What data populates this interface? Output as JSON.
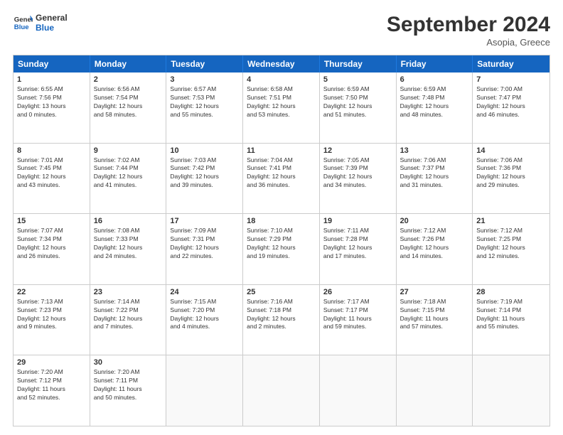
{
  "logo": {
    "line1": "General",
    "line2": "Blue"
  },
  "title": "September 2024",
  "location": "Asopia, Greece",
  "header_days": [
    "Sunday",
    "Monday",
    "Tuesday",
    "Wednesday",
    "Thursday",
    "Friday",
    "Saturday"
  ],
  "weeks": [
    [
      {
        "day": "1",
        "info": "Sunrise: 6:55 AM\nSunset: 7:56 PM\nDaylight: 13 hours\nand 0 minutes."
      },
      {
        "day": "2",
        "info": "Sunrise: 6:56 AM\nSunset: 7:54 PM\nDaylight: 12 hours\nand 58 minutes."
      },
      {
        "day": "3",
        "info": "Sunrise: 6:57 AM\nSunset: 7:53 PM\nDaylight: 12 hours\nand 55 minutes."
      },
      {
        "day": "4",
        "info": "Sunrise: 6:58 AM\nSunset: 7:51 PM\nDaylight: 12 hours\nand 53 minutes."
      },
      {
        "day": "5",
        "info": "Sunrise: 6:59 AM\nSunset: 7:50 PM\nDaylight: 12 hours\nand 51 minutes."
      },
      {
        "day": "6",
        "info": "Sunrise: 6:59 AM\nSunset: 7:48 PM\nDaylight: 12 hours\nand 48 minutes."
      },
      {
        "day": "7",
        "info": "Sunrise: 7:00 AM\nSunset: 7:47 PM\nDaylight: 12 hours\nand 46 minutes."
      }
    ],
    [
      {
        "day": "8",
        "info": "Sunrise: 7:01 AM\nSunset: 7:45 PM\nDaylight: 12 hours\nand 43 minutes."
      },
      {
        "day": "9",
        "info": "Sunrise: 7:02 AM\nSunset: 7:44 PM\nDaylight: 12 hours\nand 41 minutes."
      },
      {
        "day": "10",
        "info": "Sunrise: 7:03 AM\nSunset: 7:42 PM\nDaylight: 12 hours\nand 39 minutes."
      },
      {
        "day": "11",
        "info": "Sunrise: 7:04 AM\nSunset: 7:41 PM\nDaylight: 12 hours\nand 36 minutes."
      },
      {
        "day": "12",
        "info": "Sunrise: 7:05 AM\nSunset: 7:39 PM\nDaylight: 12 hours\nand 34 minutes."
      },
      {
        "day": "13",
        "info": "Sunrise: 7:06 AM\nSunset: 7:37 PM\nDaylight: 12 hours\nand 31 minutes."
      },
      {
        "day": "14",
        "info": "Sunrise: 7:06 AM\nSunset: 7:36 PM\nDaylight: 12 hours\nand 29 minutes."
      }
    ],
    [
      {
        "day": "15",
        "info": "Sunrise: 7:07 AM\nSunset: 7:34 PM\nDaylight: 12 hours\nand 26 minutes."
      },
      {
        "day": "16",
        "info": "Sunrise: 7:08 AM\nSunset: 7:33 PM\nDaylight: 12 hours\nand 24 minutes."
      },
      {
        "day": "17",
        "info": "Sunrise: 7:09 AM\nSunset: 7:31 PM\nDaylight: 12 hours\nand 22 minutes."
      },
      {
        "day": "18",
        "info": "Sunrise: 7:10 AM\nSunset: 7:29 PM\nDaylight: 12 hours\nand 19 minutes."
      },
      {
        "day": "19",
        "info": "Sunrise: 7:11 AM\nSunset: 7:28 PM\nDaylight: 12 hours\nand 17 minutes."
      },
      {
        "day": "20",
        "info": "Sunrise: 7:12 AM\nSunset: 7:26 PM\nDaylight: 12 hours\nand 14 minutes."
      },
      {
        "day": "21",
        "info": "Sunrise: 7:12 AM\nSunset: 7:25 PM\nDaylight: 12 hours\nand 12 minutes."
      }
    ],
    [
      {
        "day": "22",
        "info": "Sunrise: 7:13 AM\nSunset: 7:23 PM\nDaylight: 12 hours\nand 9 minutes."
      },
      {
        "day": "23",
        "info": "Sunrise: 7:14 AM\nSunset: 7:22 PM\nDaylight: 12 hours\nand 7 minutes."
      },
      {
        "day": "24",
        "info": "Sunrise: 7:15 AM\nSunset: 7:20 PM\nDaylight: 12 hours\nand 4 minutes."
      },
      {
        "day": "25",
        "info": "Sunrise: 7:16 AM\nSunset: 7:18 PM\nDaylight: 12 hours\nand 2 minutes."
      },
      {
        "day": "26",
        "info": "Sunrise: 7:17 AM\nSunset: 7:17 PM\nDaylight: 11 hours\nand 59 minutes."
      },
      {
        "day": "27",
        "info": "Sunrise: 7:18 AM\nSunset: 7:15 PM\nDaylight: 11 hours\nand 57 minutes."
      },
      {
        "day": "28",
        "info": "Sunrise: 7:19 AM\nSunset: 7:14 PM\nDaylight: 11 hours\nand 55 minutes."
      }
    ],
    [
      {
        "day": "29",
        "info": "Sunrise: 7:20 AM\nSunset: 7:12 PM\nDaylight: 11 hours\nand 52 minutes."
      },
      {
        "day": "30",
        "info": "Sunrise: 7:20 AM\nSunset: 7:11 PM\nDaylight: 11 hours\nand 50 minutes."
      },
      {
        "day": "",
        "info": ""
      },
      {
        "day": "",
        "info": ""
      },
      {
        "day": "",
        "info": ""
      },
      {
        "day": "",
        "info": ""
      },
      {
        "day": "",
        "info": ""
      }
    ]
  ]
}
